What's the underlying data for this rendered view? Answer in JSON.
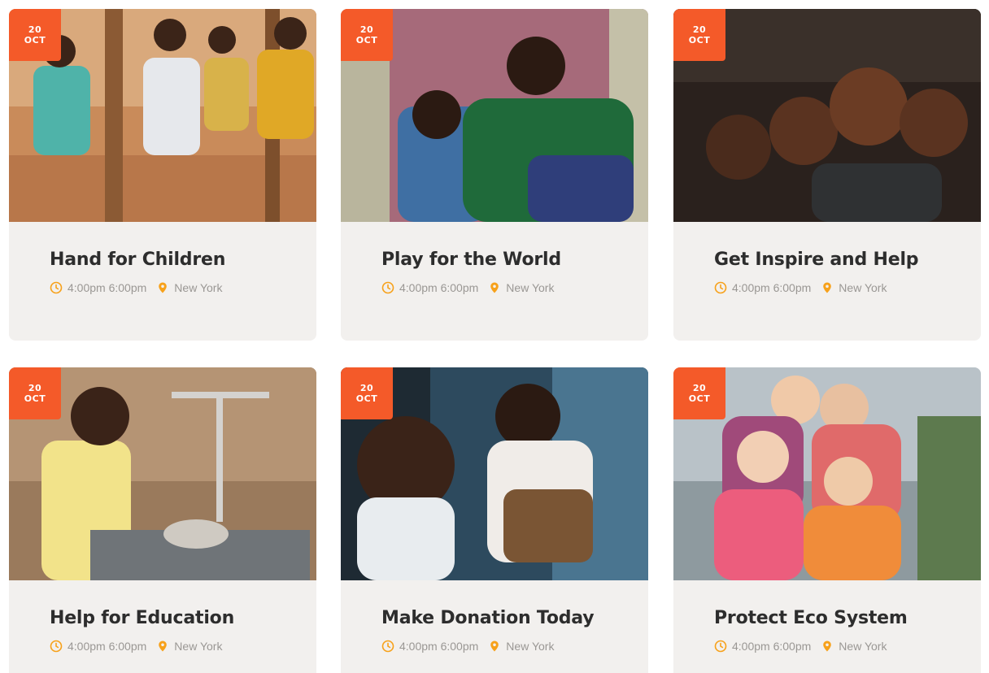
{
  "events": [
    {
      "day": "20",
      "month": "OCT",
      "title": "Hand for Children",
      "time": "4:00pm 6:00pm",
      "location": "New York"
    },
    {
      "day": "20",
      "month": "OCT",
      "title": "Play for the World",
      "time": "4:00pm 6:00pm",
      "location": "New York"
    },
    {
      "day": "20",
      "month": "OCT",
      "title": "Get Inspire and Help",
      "time": "4:00pm 6:00pm",
      "location": "New York"
    },
    {
      "day": "20",
      "month": "OCT",
      "title": "Help for Education",
      "time": "4:00pm 6:00pm",
      "location": "New York"
    },
    {
      "day": "20",
      "month": "OCT",
      "title": "Make Donation Today",
      "time": "4:00pm 6:00pm",
      "location": "New York"
    },
    {
      "day": "20",
      "month": "OCT",
      "title": "Protect Eco System",
      "time": "4:00pm 6:00pm",
      "location": "New York"
    }
  ],
  "icons": {
    "time": "clock-icon",
    "location": "map-pin-icon"
  },
  "colors": {
    "accent": "#f45a29",
    "icon": "#f7a11a",
    "card": "#f2f0ee",
    "title": "#2d2d2d",
    "meta": "#9a9794"
  }
}
